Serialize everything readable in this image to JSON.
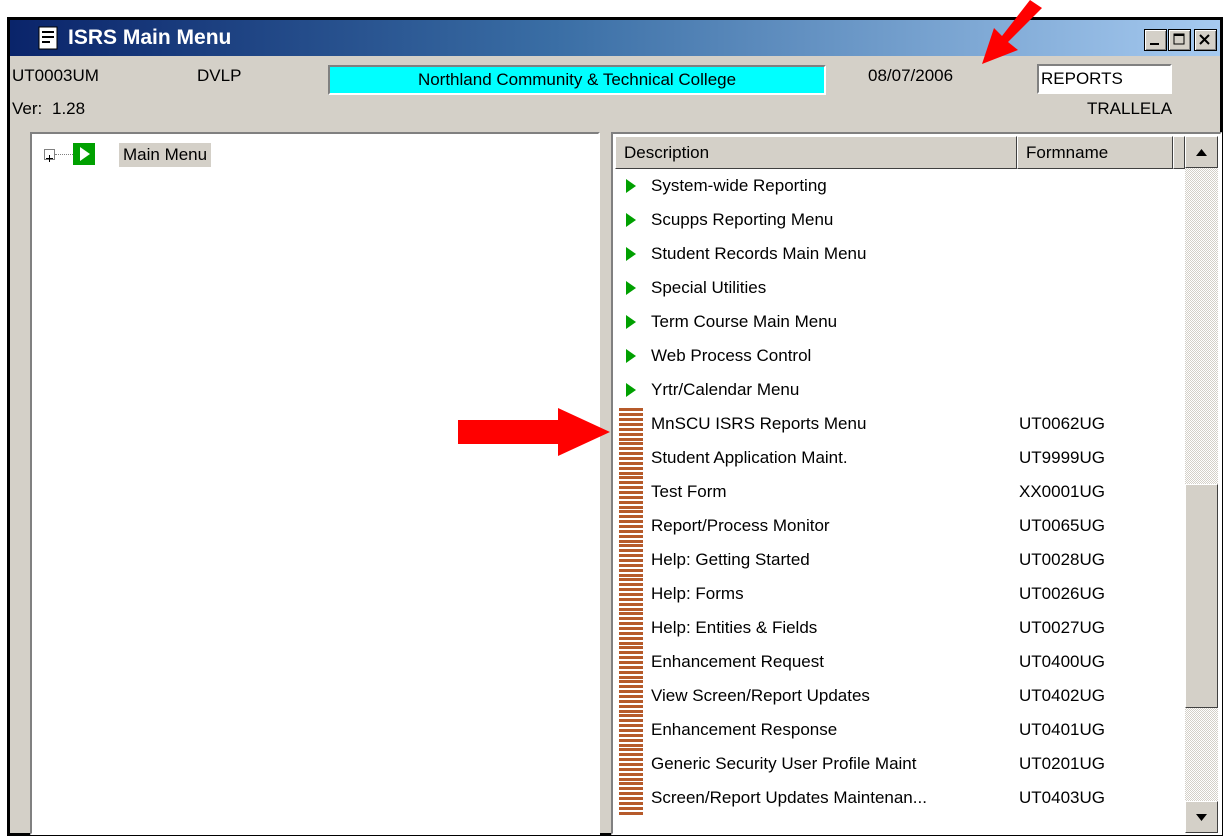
{
  "window": {
    "title": "ISRS Main Menu",
    "buttons": [
      "minimize",
      "maximize",
      "close"
    ]
  },
  "header": {
    "form_id": "UT0003UM",
    "environment": "DVLP",
    "college": "Northland Community & Technical College",
    "date": "08/07/2006",
    "search_value": "REPORTS",
    "version_label": "Ver:",
    "version": "1.28",
    "user": "TRALLELA"
  },
  "tree": {
    "root_label": "Main Menu"
  },
  "list": {
    "columns": {
      "description": "Description",
      "formname": "Formname"
    },
    "rows": [
      {
        "icon": "green-arrow-icon",
        "description": "System-wide Reporting",
        "formname": ""
      },
      {
        "icon": "green-arrow-icon",
        "description": "Scupps Reporting Menu",
        "formname": ""
      },
      {
        "icon": "green-arrow-icon",
        "description": "Student Records Main Menu",
        "formname": ""
      },
      {
        "icon": "green-arrow-icon",
        "description": "Special Utilities",
        "formname": ""
      },
      {
        "icon": "green-arrow-icon",
        "description": "Term Course Main Menu",
        "formname": ""
      },
      {
        "icon": "green-arrow-icon",
        "description": "Web Process Control",
        "formname": ""
      },
      {
        "icon": "green-arrow-icon",
        "description": "Yrtr/Calendar Menu",
        "formname": ""
      },
      {
        "icon": "form-stack-icon",
        "description": "MnSCU ISRS Reports Menu",
        "formname": "UT0062UG"
      },
      {
        "icon": "form-stack-icon",
        "description": "Student Application Maint.",
        "formname": "UT9999UG"
      },
      {
        "icon": "form-stack-icon",
        "description": "Test Form",
        "formname": "XX0001UG"
      },
      {
        "icon": "form-stack-icon",
        "description": "Report/Process Monitor",
        "formname": "UT0065UG"
      },
      {
        "icon": "form-stack-icon",
        "description": "Help: Getting Started",
        "formname": "UT0028UG"
      },
      {
        "icon": "form-stack-icon",
        "description": "Help: Forms",
        "formname": "UT0026UG"
      },
      {
        "icon": "form-stack-icon",
        "description": "Help: Entities & Fields",
        "formname": "UT0027UG"
      },
      {
        "icon": "form-stack-icon",
        "description": "Enhancement Request",
        "formname": "UT0400UG"
      },
      {
        "icon": "form-stack-icon",
        "description": "View Screen/Report Updates",
        "formname": "UT0402UG"
      },
      {
        "icon": "form-stack-icon",
        "description": "Enhancement Response",
        "formname": "UT0401UG"
      },
      {
        "icon": "form-stack-icon",
        "description": "Generic Security User Profile Maint",
        "formname": "UT0201UG"
      },
      {
        "icon": "form-stack-icon",
        "description": "Screen/Report Updates Maintenan...",
        "formname": "UT0403UG"
      }
    ]
  },
  "colors": {
    "title_gradient_start": "#0a246a",
    "title_gradient_end": "#a6caf0",
    "college_bg": "#00ffff",
    "annotation_arrow": "#ff0000",
    "menu_arrow": "#00a000",
    "form_stack": "#b65a2a"
  }
}
